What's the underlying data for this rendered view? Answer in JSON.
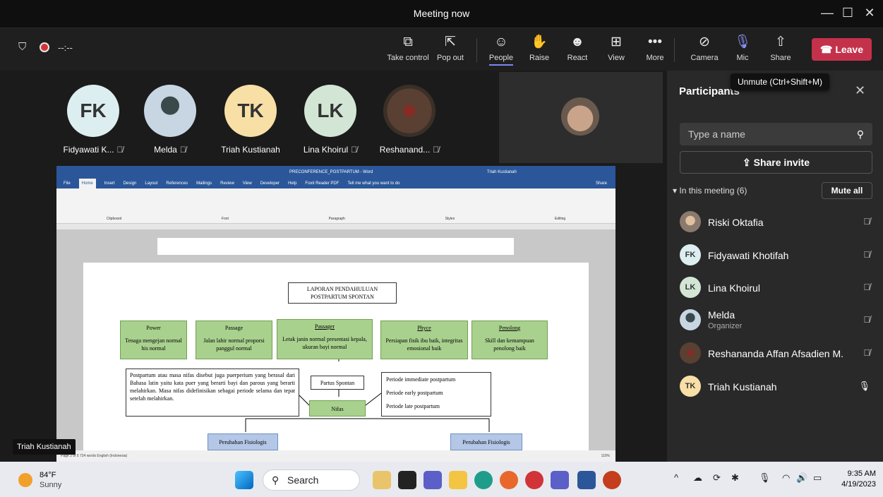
{
  "window": {
    "title": "Meeting now",
    "min": "—",
    "max": "☐",
    "close": "✕"
  },
  "topleft": {
    "timer": "--:--"
  },
  "toolbar": [
    {
      "label": "Take control",
      "icon": "⧉"
    },
    {
      "label": "Pop out",
      "icon": "⇱"
    },
    {
      "label": "People",
      "icon": "☺"
    },
    {
      "label": "Raise",
      "icon": "✋"
    },
    {
      "label": "React",
      "icon": "☻"
    },
    {
      "label": "View",
      "icon": "⊞"
    },
    {
      "label": "More",
      "icon": "•••"
    },
    {
      "label": "Camera",
      "icon": "⊘"
    },
    {
      "label": "Mic",
      "icon": "🎙"
    },
    {
      "label": "Share",
      "icon": "⇧"
    }
  ],
  "leave": "Leave",
  "tooltip": "Unmute (Ctrl+Shift+M)",
  "tiles": [
    {
      "initials": "FK",
      "name": "Fidyawati K...",
      "color": "#dceef0"
    },
    {
      "initials": "",
      "name": "Melda",
      "color": "#c8d6e4"
    },
    {
      "initials": "TK",
      "name": "Triah Kustianah",
      "color": "#f7dfa6"
    },
    {
      "initials": "LK",
      "name": "Lina Khoirul",
      "color": "#d3e6d5"
    },
    {
      "initials": "",
      "name": "Reshanand...",
      "color": "#5a4032"
    }
  ],
  "doc": {
    "window_title": "PRECONFERENCE_POSTPARTUM - Word",
    "user": "Triah Kustianah",
    "menu": [
      "File",
      "Home",
      "Insert",
      "Design",
      "Layout",
      "References",
      "Mailings",
      "Review",
      "View",
      "Developer",
      "Help",
      "Foxit Reader PDF",
      "Tell me what you want to do",
      "Share"
    ],
    "ribbon_groups": [
      "Clipboard",
      "Font",
      "Paragraph",
      "Styles",
      "Editing"
    ],
    "main_title": "LAPORAN PENDAHULUAN\nPOSTPARTUM SPONTAN",
    "green": [
      {
        "head": "Power",
        "body": "Tenaga mengejan normal his normal"
      },
      {
        "head": "Passage",
        "body": "Jalan lahir normal proporsi panggul normal"
      },
      {
        "head": "Passager",
        "body": "Letak janin normal presentasi kepala, ukuran bayi normal"
      },
      {
        "head": "Phyce",
        "body": "Persiapan fisik ibu baik, integritas emosional baik"
      },
      {
        "head": "Penolong",
        "body": "Skill dan kemampuan penolong baik"
      }
    ],
    "definition": "Postpartum atau masa nifas disebut juga puerperium yang berasal dari Bahasa latin yaitu kata puer yang berarti bayi dan parous yang berarti melahirkan. Masa nifas didefinisikan sebagai periode selama dan tepat setelah melahirkan.",
    "partus": "Partus Spontan",
    "nifas": "Nifas",
    "periods": [
      "Periode immediate postpartum",
      "Periode early postpartum",
      "Periode late postpartum"
    ],
    "fisiologis_left": "Perubahan Fisiologis",
    "fisiologis_right": "Perubahan Fisiologis",
    "status": "Page 2 of 5    724 words    English (Indonesia)",
    "zoom": "110%"
  },
  "presenter_label": "Triah Kustianah",
  "panel": {
    "title": "Participants",
    "search_placeholder": "Type a name",
    "invite": "Share invite",
    "in_meeting": "▾ In this meeting (6)",
    "mute_all": "Mute all",
    "participants": [
      {
        "name": "Riski Oktafia",
        "initials": "",
        "role": "",
        "color": "#8a7a6e",
        "mic": "muted"
      },
      {
        "name": "Fidyawati Khotifah",
        "initials": "FK",
        "role": "",
        "color": "#dceef0",
        "mic": "muted"
      },
      {
        "name": "Lina Khoirul",
        "initials": "LK",
        "role": "",
        "color": "#d3e6d5",
        "mic": "muted"
      },
      {
        "name": "Melda",
        "initials": "",
        "role": "Organizer",
        "color": "#c8d6e4",
        "mic": "muted"
      },
      {
        "name": "Reshananda Affan Afsadien M.",
        "initials": "",
        "role": "",
        "color": "#5a4032",
        "mic": "muted"
      },
      {
        "name": "Triah Kustianah",
        "initials": "TK",
        "role": "",
        "color": "#f7dfa6",
        "mic": "on"
      }
    ]
  },
  "taskbar": {
    "temp": "84°F",
    "condition": "Sunny",
    "search": "Search",
    "time": "9:35 AM",
    "date": "4/19/2023"
  }
}
